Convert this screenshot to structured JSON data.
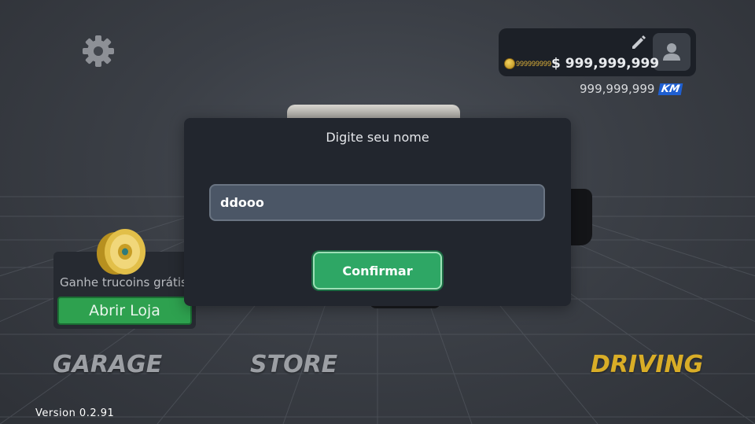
{
  "dialog": {
    "title": "Digite seu nome",
    "name_value": "ddooo",
    "confirm_label": "Confirmar"
  },
  "profile": {
    "coins": "999999999",
    "money": "$ 999,999,999",
    "distance": "999,999,999",
    "distance_unit": "KM"
  },
  "promo": {
    "text": "Ganhe trucoins grátis",
    "button_label": "Abrir Loja"
  },
  "nav": {
    "garage": "GARAGE",
    "store": "STORE",
    "driving": "DRIVING"
  },
  "version": "Version 0.2.91",
  "icons": {
    "settings": "gear-icon",
    "edit": "pencil-icon",
    "avatar": "user-icon",
    "coin": "coin-icon",
    "wheel": "wheel-icon"
  },
  "colors": {
    "active_nav": "#d9ad27",
    "inactive_nav": "#9c9fa4",
    "confirm_button": "#2ea765",
    "shop_button": "#2ea14f",
    "km_badge": "#1f5fd1"
  }
}
